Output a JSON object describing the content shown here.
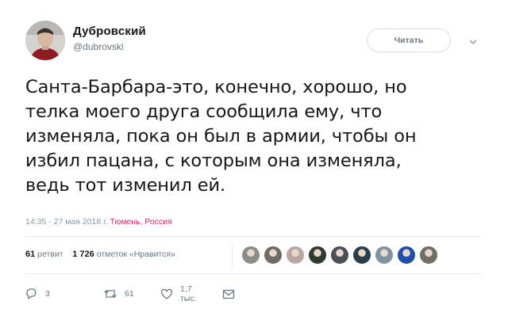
{
  "author": {
    "display_name": "Дубровский",
    "handle": "@dubrovskl"
  },
  "follow_button_label": "Читать",
  "text_lines": [
    "Санта-Барбара-это, конечно, хорошо, но",
    "телка моего друга сообщила ему, что",
    "изменяла, пока он был в армии, чтобы он",
    "избил пацана, с которым она изменяла,",
    "ведь тот изменил ей."
  ],
  "meta": {
    "time_date": "14:35 - 27 мая 2018 г.",
    "location": "Тюмень, Россия"
  },
  "stats": {
    "retweets_count": "61",
    "retweets_label": "ретвит",
    "likes_count": "1 726",
    "likes_label": "отметок «Нравится»"
  },
  "likers": [
    {
      "icon": "liker-avatar",
      "color": "#8a8f86"
    },
    {
      "icon": "liker-avatar",
      "color": "#6e6a66"
    },
    {
      "icon": "liker-avatar",
      "color": "#b9a7a3"
    },
    {
      "icon": "liker-avatar",
      "color": "#2f3a35"
    },
    {
      "icon": "liker-avatar",
      "color": "#4a4f58"
    },
    {
      "icon": "liker-avatar",
      "color": "#2c3c4a"
    },
    {
      "icon": "liker-avatar",
      "color": "#7e92a2"
    },
    {
      "icon": "liker-avatar",
      "color": "#1f4fa8"
    },
    {
      "icon": "liker-avatar",
      "color": "#6f7063"
    }
  ],
  "actions": {
    "reply_count": "3",
    "retweet_count": "61",
    "like_count": "1,7 тыс."
  },
  "colors": {
    "text": "#14171a",
    "secondary": "#657786",
    "location": "#e0245e",
    "border": "#e6ecf0"
  }
}
